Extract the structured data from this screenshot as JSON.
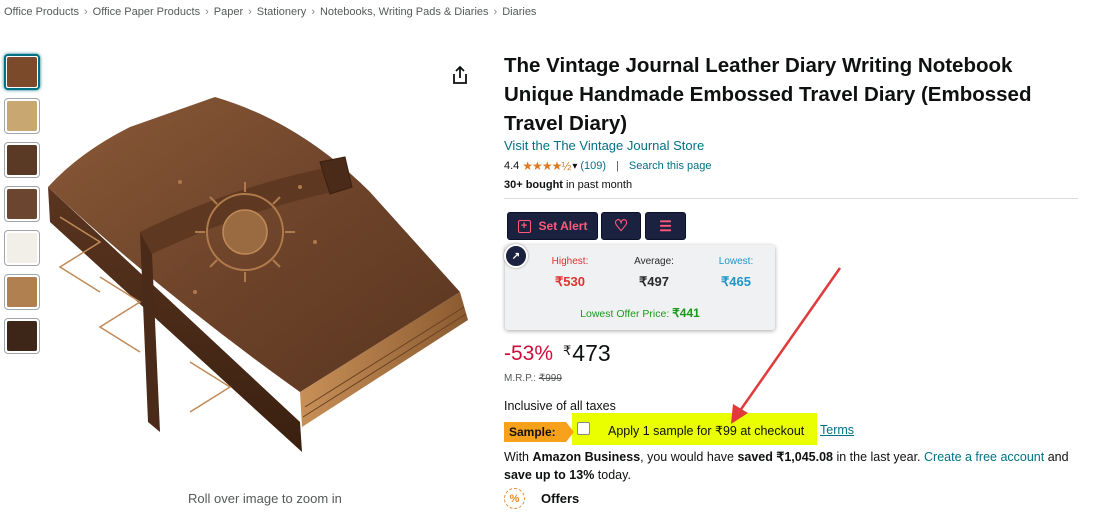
{
  "breadcrumb": [
    "Office Products",
    "Office Paper Products",
    "Paper",
    "Stationery",
    "Notebooks, Writing Pads & Diaries",
    "Diaries"
  ],
  "breadcrumb_separator": "›",
  "gallery": {
    "thumbnail_colors": [
      "#7a4a2a",
      "#c8a870",
      "#5a3a25",
      "#6b4530",
      "#f2eee8",
      "#b08050",
      "#3d2618"
    ],
    "zoom_hint": "Roll over image to zoom in"
  },
  "product": {
    "title": "The Vintage Journal Leather Diary Writing Notebook Unique Handmade Embossed Travel Diary (Embossed Travel Diary)",
    "store_link": "Visit the The Vintage Journal Store",
    "rating_value": "4.4",
    "stars": "★★★★½",
    "rating_count": "(109)",
    "search_page": "Search this page",
    "bought_bold": "30+ bought",
    "bought_rest": " in past month"
  },
  "tools": {
    "set_alert_label": "Set Alert",
    "plus_glyph": "+",
    "heart_glyph": "♡",
    "list_glyph": "☰"
  },
  "price_tracker": {
    "logo_glyph": "↗",
    "highest_label": "Highest:",
    "highest_value": "₹530",
    "average_label": "Average:",
    "average_value": "₹497",
    "lowest_label": "Lowest:",
    "lowest_value": "₹465",
    "lowest_offer_label": "Lowest Offer Price: ",
    "lowest_offer_value": "₹441"
  },
  "pricing": {
    "discount": "-53%",
    "currency": "₹",
    "price": "473",
    "mrp_label": "M.R.P.: ",
    "mrp_value": "₹999",
    "taxes": "Inclusive of all taxes"
  },
  "sample": {
    "badge": "Sample:",
    "text": "Apply 1 sample for ₹99 at checkout",
    "terms": "Terms"
  },
  "business": {
    "prefix": "With ",
    "brand": "Amazon Business",
    "middle": ", you would have ",
    "saved": "saved ₹1,045.08",
    "after_saved": " in the last year. ",
    "create_link": "Create a free account",
    "and": " and",
    "save_up": "save up to 13%",
    "today": " today."
  },
  "offers": {
    "icon_glyph": "%",
    "label": "Offers"
  },
  "colors": {
    "link": "#007185",
    "discount": "#cc0c39",
    "badge": "#f7a11a",
    "highlight": "#eaff00",
    "tool_button": "#1b2240",
    "annotation_arrow": "#e03a3a"
  }
}
